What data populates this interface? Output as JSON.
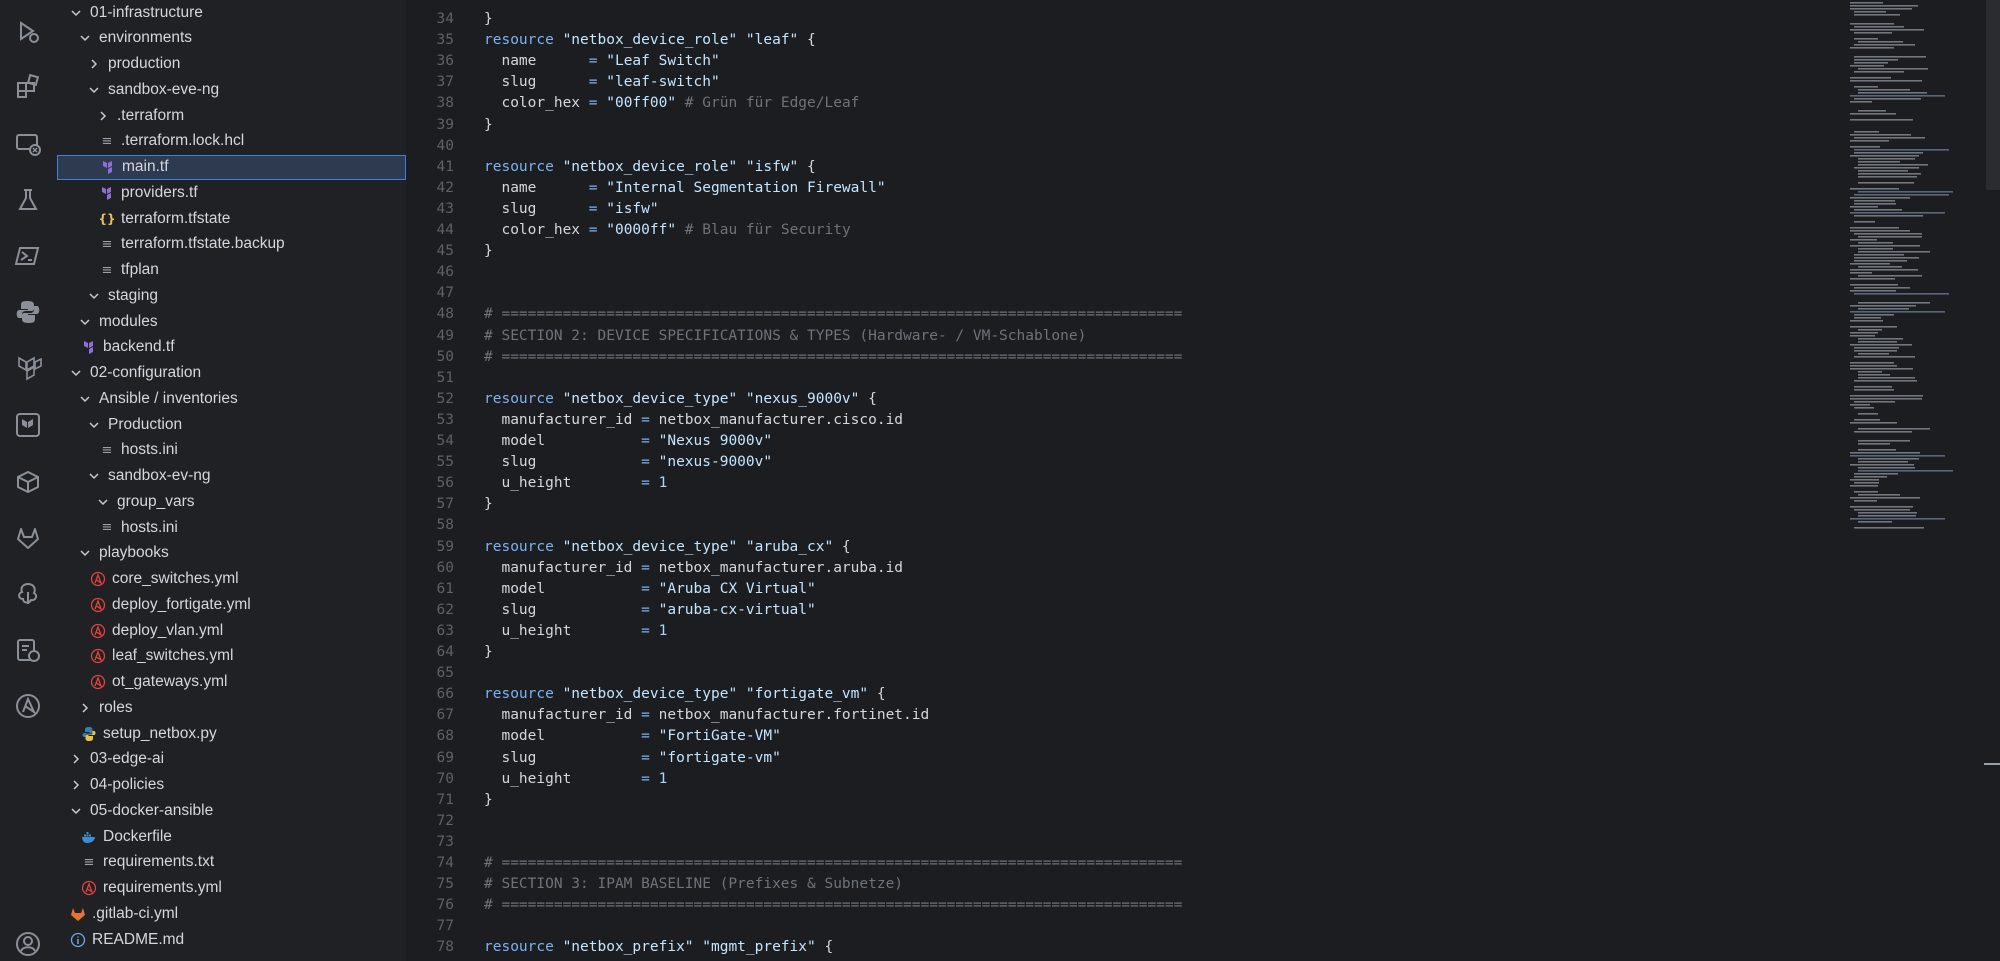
{
  "activity_bar": {
    "icons": [
      "run-debug-icon",
      "extensions-icon",
      "remote-explorer-icon",
      "testing-icon",
      "powershell-icon",
      "python-icon",
      "terraform-icon",
      "terraform-cloud-icon",
      "containers-icon",
      "gitlab-icon",
      "git-graph-icon",
      "ci-status-icon",
      "ansible-icon",
      "account-icon"
    ]
  },
  "explorer": {
    "items": [
      {
        "label": "01-infrastructure",
        "type": "folder",
        "open": true,
        "depth": 0
      },
      {
        "label": "environments",
        "type": "folder",
        "open": true,
        "depth": 1
      },
      {
        "label": "production",
        "type": "folder",
        "open": false,
        "depth": 2
      },
      {
        "label": "sandbox-eve-ng",
        "type": "folder",
        "open": true,
        "depth": 2
      },
      {
        "label": ".terraform",
        "type": "folder",
        "open": false,
        "depth": 3
      },
      {
        "label": ".terraform.lock.hcl",
        "type": "lines",
        "depth": 3
      },
      {
        "label": "main.tf",
        "type": "terraform",
        "depth": 3,
        "selected": true
      },
      {
        "label": "providers.tf",
        "type": "terraform",
        "depth": 3
      },
      {
        "label": "terraform.tfstate",
        "type": "json",
        "depth": 3
      },
      {
        "label": "terraform.tfstate.backup",
        "type": "lines",
        "depth": 3
      },
      {
        "label": "tfplan",
        "type": "lines",
        "depth": 3
      },
      {
        "label": "staging",
        "type": "folder",
        "open": true,
        "depth": 2
      },
      {
        "label": "modules",
        "type": "folder",
        "open": true,
        "depth": 1
      },
      {
        "label": "backend.tf",
        "type": "terraform",
        "depth": 1
      },
      {
        "label": "02-configuration",
        "type": "folder",
        "open": true,
        "depth": 0
      },
      {
        "label": "Ansible / inventories",
        "type": "folder",
        "open": true,
        "depth": 1
      },
      {
        "label": "Production",
        "type": "folder",
        "open": true,
        "depth": 2
      },
      {
        "label": "hosts.ini",
        "type": "lines",
        "depth": 3
      },
      {
        "label": "sandbox-ev-ng",
        "type": "folder",
        "open": true,
        "depth": 2
      },
      {
        "label": "group_vars",
        "type": "folder",
        "open": true,
        "depth": 3
      },
      {
        "label": "hosts.ini",
        "type": "lines",
        "depth": 3
      },
      {
        "label": "playbooks",
        "type": "folder",
        "open": true,
        "depth": 1
      },
      {
        "label": "core_switches.yml",
        "type": "ansible",
        "depth": 2
      },
      {
        "label": "deploy_fortigate.yml",
        "type": "ansible",
        "depth": 2
      },
      {
        "label": "deploy_vlan.yml",
        "type": "ansible",
        "depth": 2
      },
      {
        "label": "leaf_switches.yml",
        "type": "ansible",
        "depth": 2
      },
      {
        "label": "ot_gateways.yml",
        "type": "ansible",
        "depth": 2
      },
      {
        "label": "roles",
        "type": "folder",
        "open": false,
        "depth": 1
      },
      {
        "label": "setup_netbox.py",
        "type": "python",
        "depth": 1
      },
      {
        "label": "03-edge-ai",
        "type": "folder",
        "open": false,
        "depth": 0
      },
      {
        "label": "04-policies",
        "type": "folder",
        "open": false,
        "depth": 0
      },
      {
        "label": "05-docker-ansible",
        "type": "folder",
        "open": true,
        "depth": 0
      },
      {
        "label": "Dockerfile",
        "type": "docker",
        "depth": 1
      },
      {
        "label": "requirements.txt",
        "type": "lines",
        "depth": 1
      },
      {
        "label": "requirements.yml",
        "type": "ansible",
        "depth": 1
      },
      {
        "label": ".gitlab-ci.yml",
        "type": "gitlab",
        "depth": 0
      },
      {
        "label": "README.md",
        "type": "info",
        "depth": 0
      }
    ]
  },
  "editor": {
    "lines": [
      {
        "n": "34",
        "t": [
          [
            "op",
            "}"
          ]
        ]
      },
      {
        "n": "35",
        "t": [
          [
            "kw",
            "resource "
          ],
          [
            "str",
            "\"netbox_device_role\" \"leaf\""
          ],
          [
            "op",
            " {"
          ]
        ]
      },
      {
        "n": "36",
        "t": [
          [
            "op",
            "  name      "
          ],
          [
            "eq",
            "="
          ],
          [
            "str",
            " \"Leaf Switch\""
          ]
        ]
      },
      {
        "n": "37",
        "t": [
          [
            "op",
            "  slug      "
          ],
          [
            "eq",
            "="
          ],
          [
            "str",
            " \"leaf-switch\""
          ]
        ]
      },
      {
        "n": "38",
        "t": [
          [
            "op",
            "  color_hex "
          ],
          [
            "eq",
            "="
          ],
          [
            "str",
            " \"00ff00\""
          ],
          [
            "cmt",
            " # Grün für Edge/Leaf"
          ]
        ]
      },
      {
        "n": "39",
        "t": [
          [
            "op",
            "}"
          ]
        ]
      },
      {
        "n": "40",
        "t": []
      },
      {
        "n": "41",
        "t": [
          [
            "kw",
            "resource "
          ],
          [
            "str",
            "\"netbox_device_role\" \"isfw\""
          ],
          [
            "op",
            " {"
          ]
        ]
      },
      {
        "n": "42",
        "t": [
          [
            "op",
            "  name      "
          ],
          [
            "eq",
            "="
          ],
          [
            "str",
            " \"Internal Segmentation Firewall\""
          ]
        ]
      },
      {
        "n": "43",
        "t": [
          [
            "op",
            "  slug      "
          ],
          [
            "eq",
            "="
          ],
          [
            "str",
            " \"isfw\""
          ]
        ]
      },
      {
        "n": "44",
        "t": [
          [
            "op",
            "  color_hex "
          ],
          [
            "eq",
            "="
          ],
          [
            "str",
            " \"0000ff\""
          ],
          [
            "cmt",
            " # Blau für Security"
          ]
        ]
      },
      {
        "n": "45",
        "t": [
          [
            "op",
            "}"
          ]
        ]
      },
      {
        "n": "46",
        "t": []
      },
      {
        "n": "47",
        "t": []
      },
      {
        "n": "48",
        "t": [
          [
            "cmt",
            "# =============================================================================="
          ]
        ]
      },
      {
        "n": "49",
        "t": [
          [
            "cmt",
            "# SECTION 2: DEVICE SPECIFICATIONS & TYPES (Hardware- / VM-Schablone)"
          ]
        ]
      },
      {
        "n": "50",
        "t": [
          [
            "cmt",
            "# =============================================================================="
          ]
        ]
      },
      {
        "n": "51",
        "t": []
      },
      {
        "n": "52",
        "t": [
          [
            "kw",
            "resource "
          ],
          [
            "str",
            "\"netbox_device_type\" \"nexus_9000v\""
          ],
          [
            "op",
            " {"
          ]
        ]
      },
      {
        "n": "53",
        "t": [
          [
            "op",
            "  manufacturer_id "
          ],
          [
            "eq",
            "="
          ],
          [
            "op",
            " netbox_manufacturer.cisco.id"
          ]
        ]
      },
      {
        "n": "54",
        "t": [
          [
            "op",
            "  model           "
          ],
          [
            "eq",
            "="
          ],
          [
            "str",
            " \"Nexus 9000v\""
          ]
        ]
      },
      {
        "n": "55",
        "t": [
          [
            "op",
            "  slug            "
          ],
          [
            "eq",
            "="
          ],
          [
            "str",
            " \"nexus-9000v\""
          ]
        ]
      },
      {
        "n": "56",
        "t": [
          [
            "op",
            "  u_height        "
          ],
          [
            "eq",
            "="
          ],
          [
            "num",
            " 1"
          ]
        ]
      },
      {
        "n": "57",
        "t": [
          [
            "op",
            "}"
          ]
        ]
      },
      {
        "n": "58",
        "t": []
      },
      {
        "n": "59",
        "t": [
          [
            "kw",
            "resource "
          ],
          [
            "str",
            "\"netbox_device_type\" \"aruba_cx\""
          ],
          [
            "op",
            " {"
          ]
        ]
      },
      {
        "n": "60",
        "t": [
          [
            "op",
            "  manufacturer_id "
          ],
          [
            "eq",
            "="
          ],
          [
            "op",
            " netbox_manufacturer.aruba.id"
          ]
        ]
      },
      {
        "n": "61",
        "t": [
          [
            "op",
            "  model           "
          ],
          [
            "eq",
            "="
          ],
          [
            "str",
            " \"Aruba CX Virtual\""
          ]
        ]
      },
      {
        "n": "62",
        "t": [
          [
            "op",
            "  slug            "
          ],
          [
            "eq",
            "="
          ],
          [
            "str",
            " \"aruba-cx-virtual\""
          ]
        ]
      },
      {
        "n": "63",
        "t": [
          [
            "op",
            "  u_height        "
          ],
          [
            "eq",
            "="
          ],
          [
            "num",
            " 1"
          ]
        ]
      },
      {
        "n": "64",
        "t": [
          [
            "op",
            "}"
          ]
        ]
      },
      {
        "n": "65",
        "t": []
      },
      {
        "n": "66",
        "t": [
          [
            "kw",
            "resource "
          ],
          [
            "str",
            "\"netbox_device_type\" \"fortigate_vm\""
          ],
          [
            "op",
            " {"
          ]
        ]
      },
      {
        "n": "67",
        "t": [
          [
            "op",
            "  manufacturer_id "
          ],
          [
            "eq",
            "="
          ],
          [
            "op",
            " netbox_manufacturer.fortinet.id"
          ]
        ]
      },
      {
        "n": "68",
        "t": [
          [
            "op",
            "  model           "
          ],
          [
            "eq",
            "="
          ],
          [
            "str",
            " \"FortiGate-VM\""
          ]
        ]
      },
      {
        "n": "69",
        "t": [
          [
            "op",
            "  slug            "
          ],
          [
            "eq",
            "="
          ],
          [
            "str",
            " \"fortigate-vm\""
          ]
        ]
      },
      {
        "n": "70",
        "t": [
          [
            "op",
            "  u_height        "
          ],
          [
            "eq",
            "="
          ],
          [
            "num",
            " 1"
          ]
        ]
      },
      {
        "n": "71",
        "t": [
          [
            "op",
            "}"
          ]
        ]
      },
      {
        "n": "72",
        "t": []
      },
      {
        "n": "73",
        "t": []
      },
      {
        "n": "74",
        "t": [
          [
            "cmt",
            "# =============================================================================="
          ]
        ]
      },
      {
        "n": "75",
        "t": [
          [
            "cmt",
            "# SECTION 3: IPAM BASELINE (Prefixes & Subnetze)"
          ]
        ]
      },
      {
        "n": "76",
        "t": [
          [
            "cmt",
            "# =============================================================================="
          ]
        ]
      },
      {
        "n": "77",
        "t": []
      },
      {
        "n": "78",
        "t": [
          [
            "kw",
            "resource "
          ],
          [
            "str",
            "\"netbox_prefix\" \"mgmt_prefix\""
          ],
          [
            "op",
            " {"
          ]
        ]
      }
    ]
  }
}
